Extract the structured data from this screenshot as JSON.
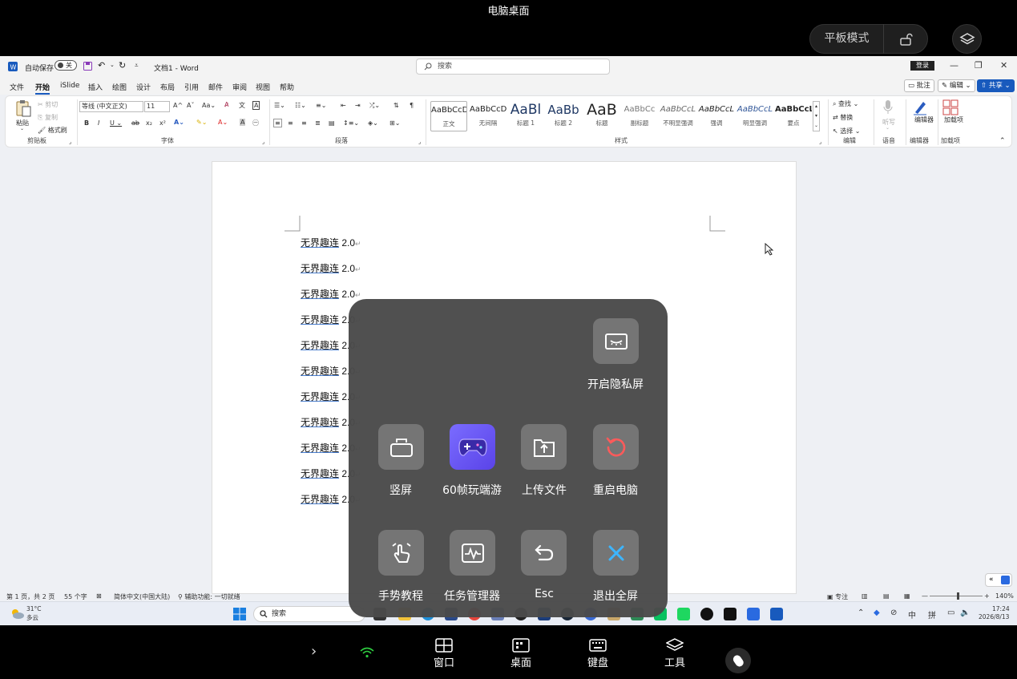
{
  "top": {
    "title": "电脑桌面",
    "tablet_mode_label": "平板模式"
  },
  "word": {
    "autosave_label": "自动保存",
    "autosave_state": "关",
    "doc_title": "文档1 - Word",
    "search_placeholder": "搜索",
    "login_label": "登录",
    "tabs": [
      "文件",
      "开始",
      "iSlide",
      "插入",
      "绘图",
      "设计",
      "布局",
      "引用",
      "邮件",
      "审阅",
      "视图",
      "帮助"
    ],
    "comment_label": "批注",
    "edit_label": "编辑",
    "share_label": "共享",
    "ribbon": {
      "paste": "粘贴",
      "cut": "剪切",
      "copy": "复制",
      "format_painter": "格式刷",
      "clipboard_group": "剪贴板",
      "font_name": "等线 (中文正文)",
      "font_size": "11",
      "font_group": "字体",
      "paragraph_group": "段落",
      "styles_group": "样式",
      "styles": [
        {
          "preview": "AaBbCcD",
          "name": "正文"
        },
        {
          "preview": "AaBbCcD",
          "name": "无间隔"
        },
        {
          "preview": "AaBl",
          "name": "标题 1"
        },
        {
          "preview": "AaBb",
          "name": "标题 2"
        },
        {
          "preview": "AaB",
          "name": "标题"
        },
        {
          "preview": "AaBbCc",
          "name": "副标题"
        },
        {
          "preview": "AaBbCcL",
          "name": "不明显强调"
        },
        {
          "preview": "AaBbCcL",
          "name": "强调"
        },
        {
          "preview": "AaBbCcL",
          "name": "明显强调"
        },
        {
          "preview": "AaBbCcL",
          "name": "要点"
        }
      ],
      "find": "查找",
      "replace": "替换",
      "select": "选择",
      "editing_group": "编辑",
      "dictate": "听写",
      "voice_group": "语音",
      "editor": "编辑器",
      "editor_group": "编辑器",
      "addins": "加载项",
      "addins_group": "加载项"
    },
    "doc_lines": [
      {
        "zh": "无界趣连",
        "ver": " 2.0"
      },
      {
        "zh": "无界趣连",
        "ver": " 2.0"
      },
      {
        "zh": "无界趣连",
        "ver": " 2.0"
      },
      {
        "zh": "无界趣连",
        "ver": " 2.0"
      },
      {
        "zh": "无界趣连",
        "ver": " 2.0"
      },
      {
        "zh": "无界趣连",
        "ver": " 2.0"
      },
      {
        "zh": "无界趣连",
        "ver": " 2.0"
      },
      {
        "zh": "无界趣连",
        "ver": " 2.0"
      },
      {
        "zh": "无界趣连",
        "ver": " 2.0"
      },
      {
        "zh": "无界趣连",
        "ver": " 2.0"
      },
      {
        "zh": "无界趣连",
        "ver": " 2.0"
      }
    ],
    "paragraph_mark": "↵",
    "status": {
      "page": "第 1 页，共 2 页",
      "words": "55 个字",
      "language": "简体中文(中国大陆)",
      "accessibility": "辅助功能: 一切就绪",
      "focus": "专注",
      "zoom": "140%"
    }
  },
  "taskbar": {
    "weather_temp": "31°C",
    "weather_desc": "多云",
    "search": "搜索",
    "ime1": "中",
    "ime2": "拼",
    "time": "17:24",
    "date": "2026/8/13"
  },
  "overlay": {
    "privacy": "开启隐私屏",
    "portrait": "竖屏",
    "game60": "60帧玩端游",
    "upload": "上传文件",
    "restart": "重启电脑",
    "gesture": "手势教程",
    "taskmgr": "任务管理器",
    "esc": "Esc",
    "exit_fullscreen": "退出全屏"
  },
  "bottom": {
    "window": "窗口",
    "desktop": "桌面",
    "keyboard": "键盘",
    "tools": "工具"
  }
}
